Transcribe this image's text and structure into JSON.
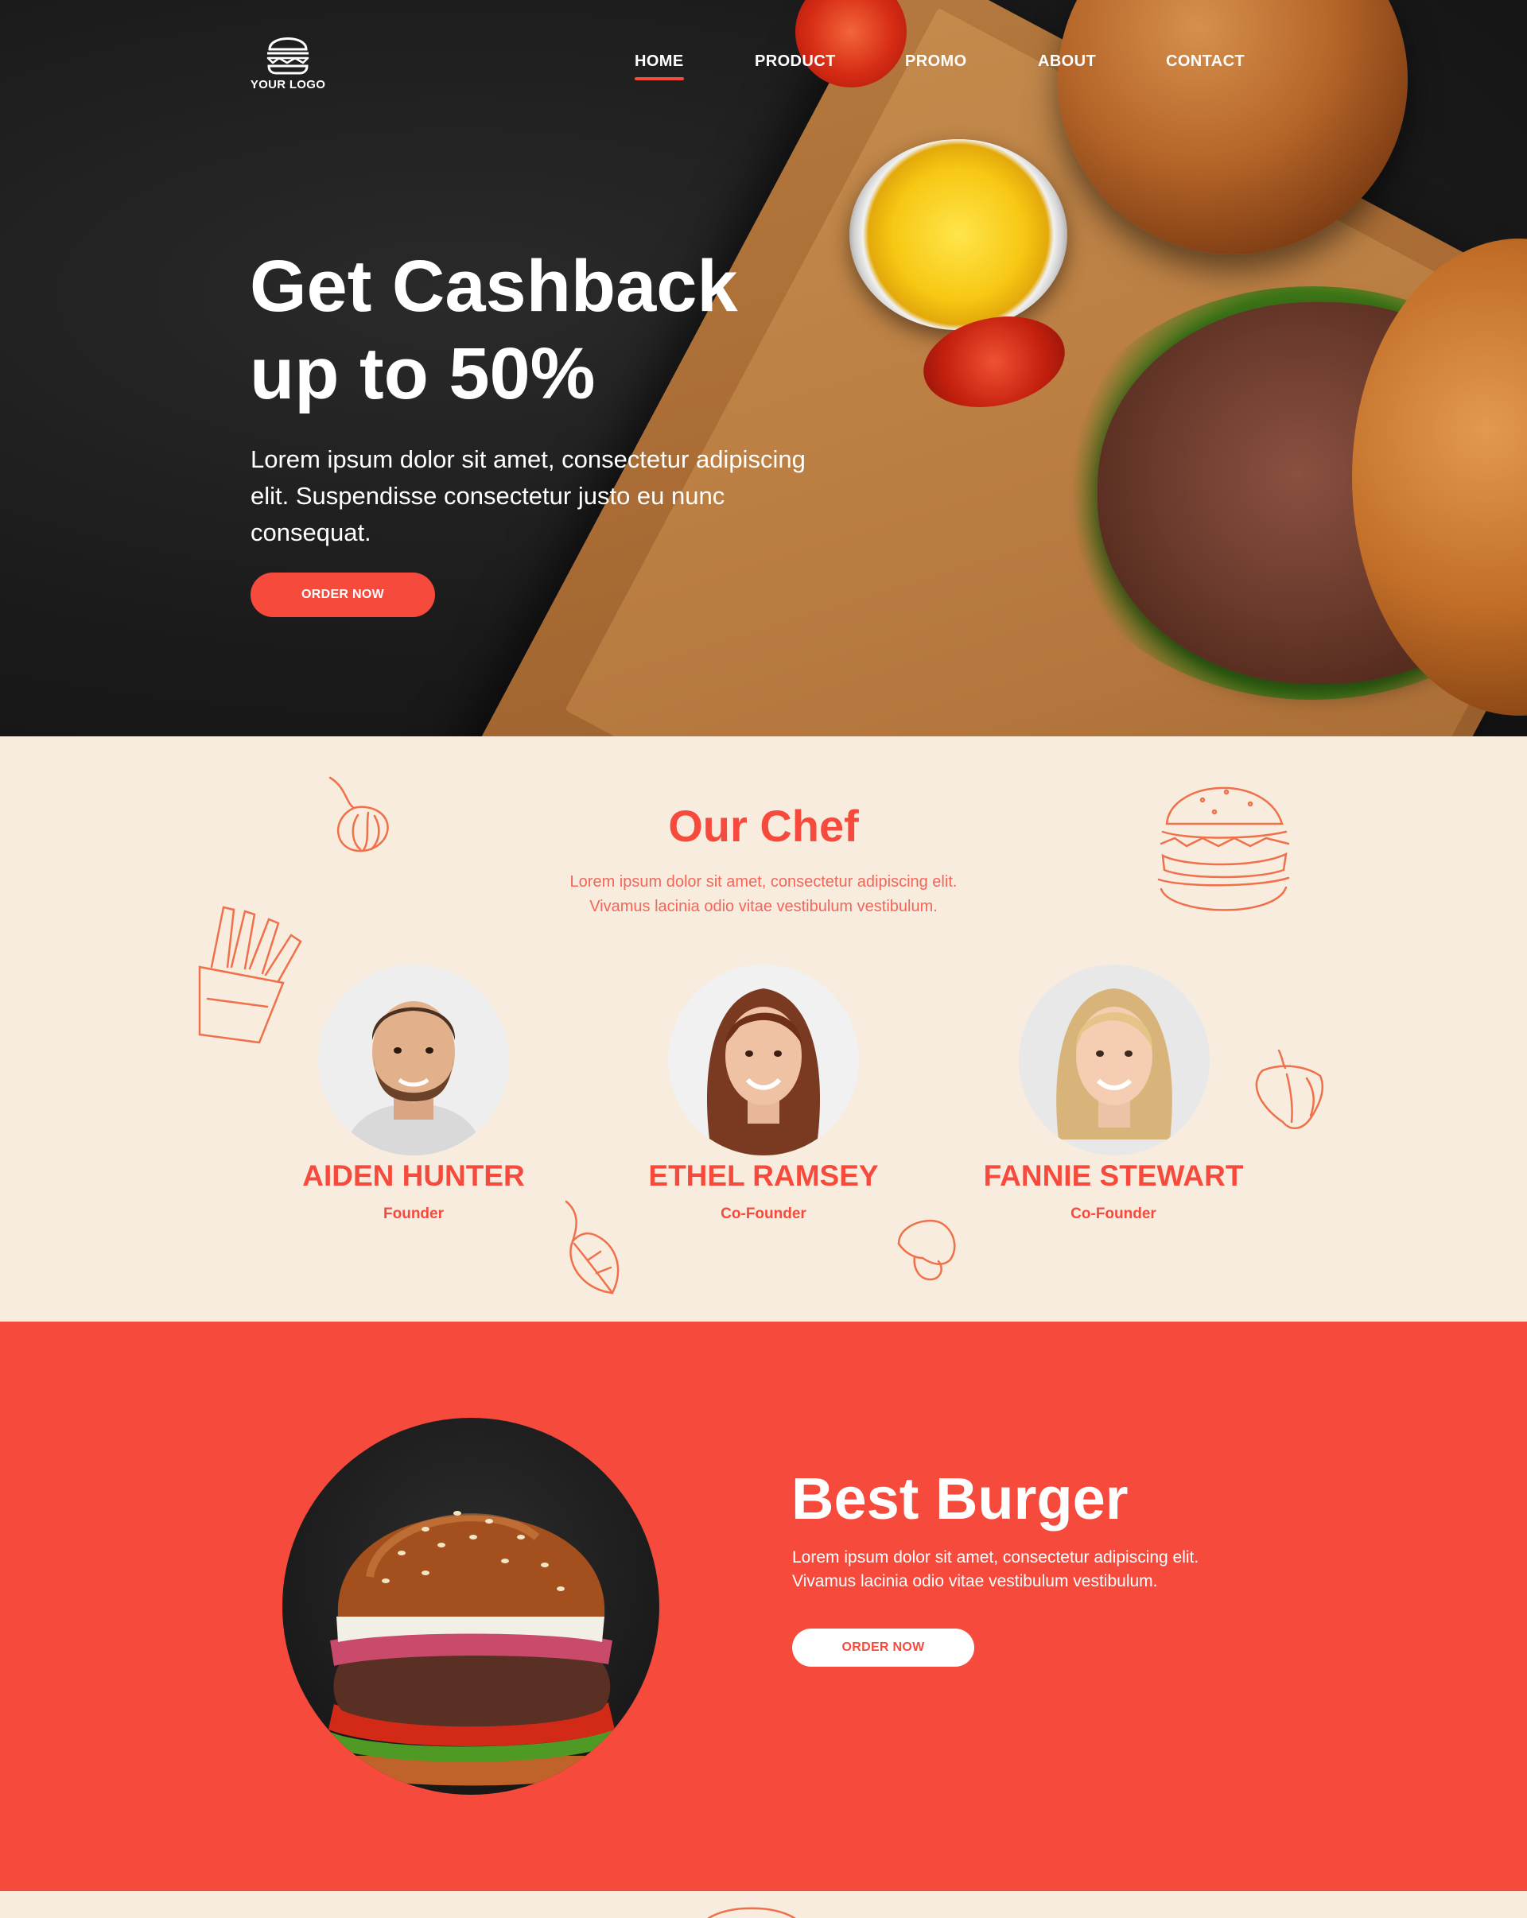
{
  "colors": {
    "accent": "#f64b3c",
    "cream": "#f7ecde",
    "dark": "#1b1b1b",
    "white": "#ffffff"
  },
  "logo": {
    "text": "YOUR LOGO",
    "icon": "burger-icon"
  },
  "nav": {
    "items": [
      "HOME",
      "PRODUCT",
      "PROMO",
      "ABOUT",
      "CONTACT"
    ],
    "active": "HOME"
  },
  "hero": {
    "title_line1": "Get Cashback",
    "title_line2": "up to 50%",
    "text": "Lorem ipsum dolor sit amet, consectetur adipiscing elit. Suspendisse consectetur justo eu nunc consequat.",
    "button": "ORDER NOW"
  },
  "chef": {
    "title": "Our Chef",
    "subtitle_line1": "Lorem ipsum dolor sit amet, consectetur adipiscing elit.",
    "subtitle_line2": "Vivamus lacinia odio vitae vestibulum vestibulum.",
    "people": [
      {
        "name": "AIDEN HUNTER",
        "role": "Founder"
      },
      {
        "name": "ETHEL RAMSEY",
        "role": "Co-Founder"
      },
      {
        "name": "FANNIE STEWART",
        "role": "Co-Founder"
      }
    ],
    "doodles": [
      "garlic-doodle",
      "burger-doodle",
      "fries-doodle",
      "pepper-doodle",
      "leaf-doodle",
      "mushroom-doodle"
    ]
  },
  "best": {
    "title": "Best Burger",
    "text_line1": "Lorem ipsum dolor sit amet, consectetur adipiscing elit.",
    "text_line2": "Vivamus lacinia odio vitae vestibulum vestibulum.",
    "button": "ORDER NOW"
  }
}
